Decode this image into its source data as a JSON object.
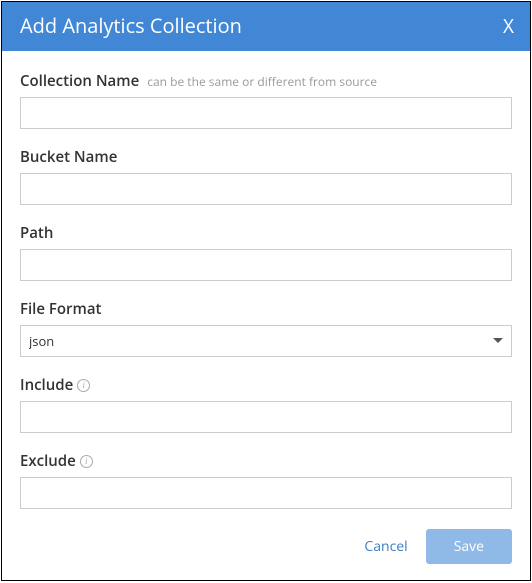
{
  "header": {
    "title": "Add Analytics Collection",
    "close": "X"
  },
  "fields": {
    "collection_name": {
      "label": "Collection Name",
      "hint": "can be the same or different from source",
      "value": ""
    },
    "bucket_name": {
      "label": "Bucket Name",
      "value": ""
    },
    "path": {
      "label": "Path",
      "value": ""
    },
    "file_format": {
      "label": "File Format",
      "value": "json"
    },
    "include": {
      "label": "Include",
      "value": ""
    },
    "exclude": {
      "label": "Exclude",
      "value": ""
    }
  },
  "footer": {
    "cancel": "Cancel",
    "save": "Save"
  }
}
